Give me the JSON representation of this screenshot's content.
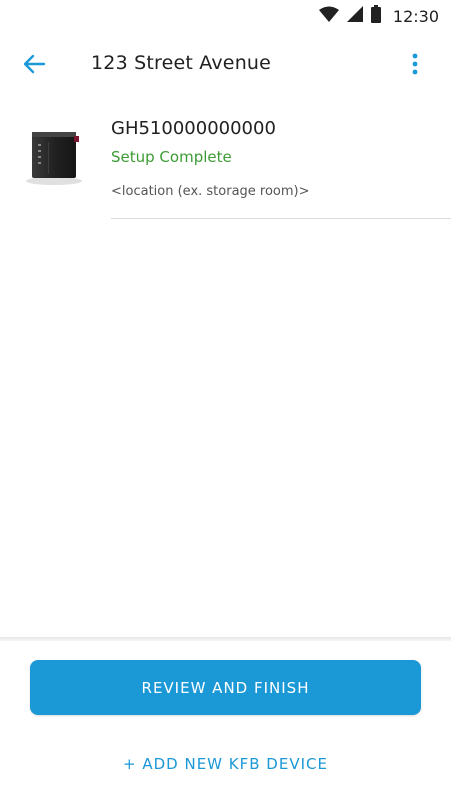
{
  "status_bar": {
    "time": "12:30",
    "wifi_icon": "wifi-icon",
    "signal_icon": "cellular-signal-icon",
    "battery_icon": "battery-icon"
  },
  "header": {
    "back_icon": "arrow-left-icon",
    "title": "123 Street Avenue",
    "menu_icon": "more-vertical-icon"
  },
  "device": {
    "name": "GH510000000000",
    "status": "Setup Complete",
    "location": "<location (ex. storage room)>"
  },
  "actions": {
    "primary_label": "REVIEW AND FINISH",
    "secondary_label": "+ ADD NEW KFB DEVICE"
  },
  "colors": {
    "accent": "#1b98d6",
    "success": "#3d9b35",
    "text_primary": "#212121"
  }
}
